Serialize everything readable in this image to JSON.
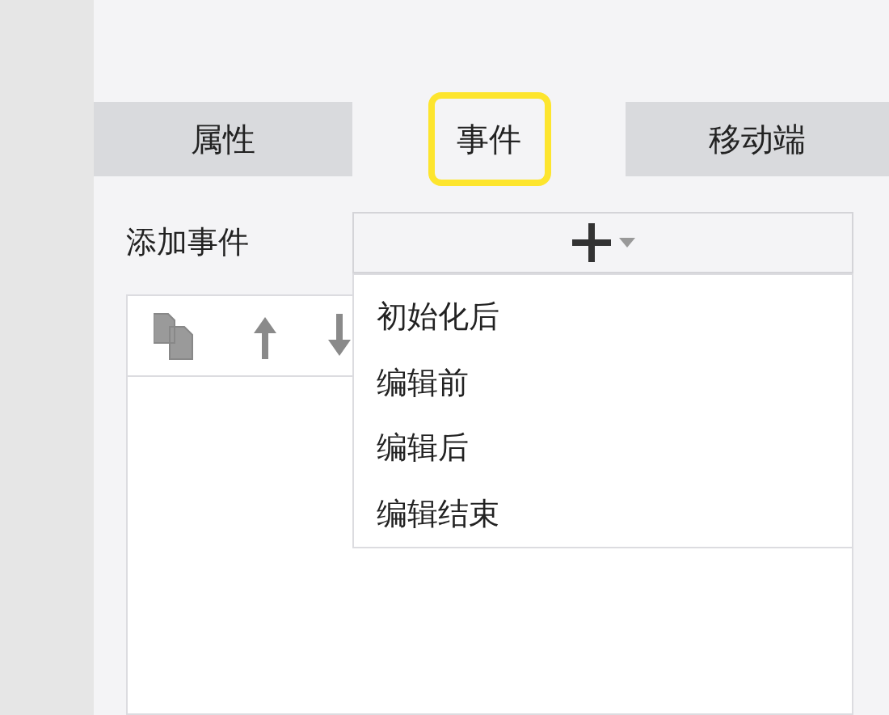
{
  "tabs": [
    {
      "label": "属性",
      "selected": false
    },
    {
      "label": "事件",
      "selected": true
    },
    {
      "label": "移动端",
      "selected": false
    }
  ],
  "add_event": {
    "label": "添加事件",
    "expanded": true,
    "menu": [
      "初始化后",
      "编辑前",
      "编辑后",
      "编辑结束"
    ]
  }
}
